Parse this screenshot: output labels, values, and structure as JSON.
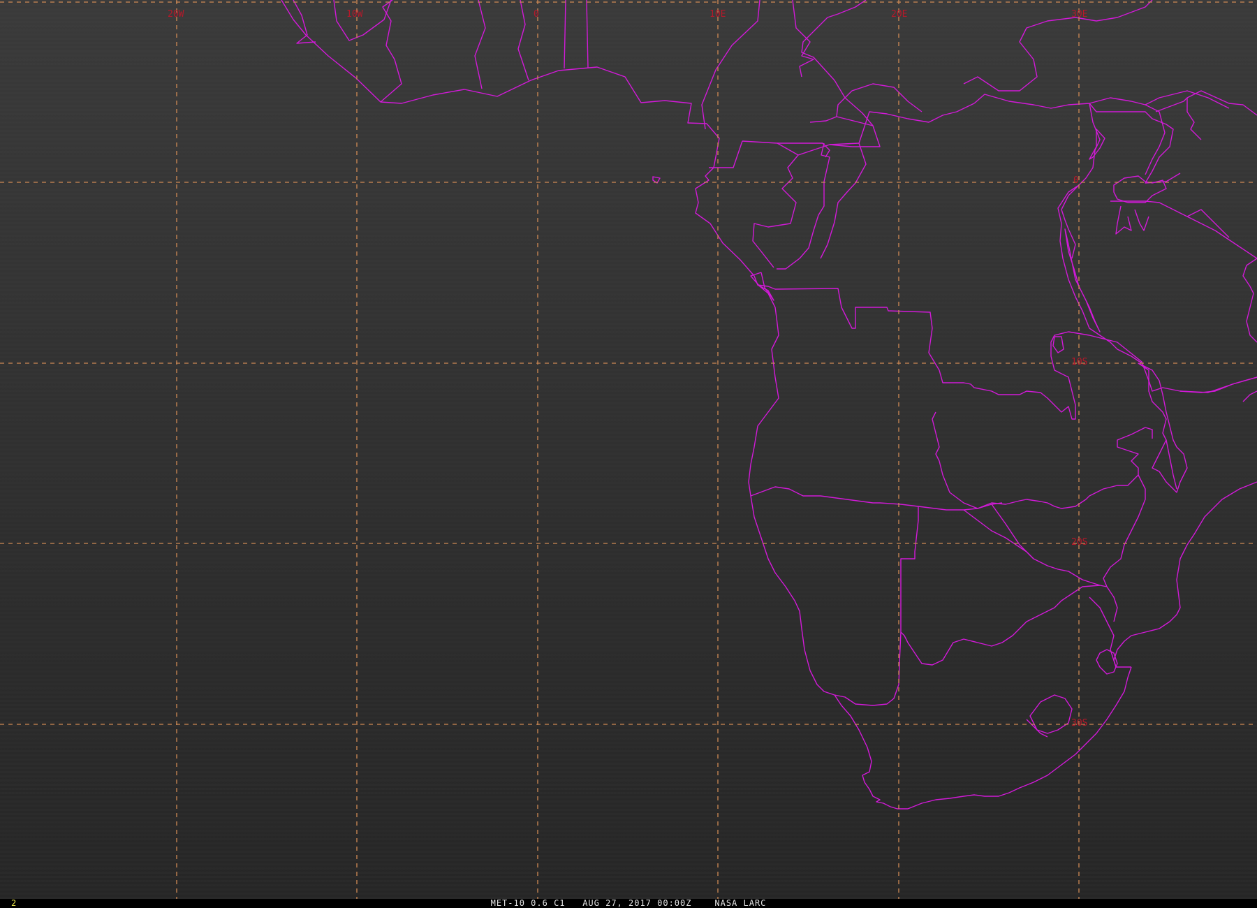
{
  "map": {
    "background_colors": [
      "#3a3a3a",
      "#262626"
    ],
    "grid_color": "#d08a55",
    "label_color": "#b8182a",
    "border_color": "#d21ad8",
    "lon_labels": [
      "20W",
      "10W",
      "0",
      "10E",
      "20E",
      "30E"
    ],
    "lat_labels": [
      "0",
      "10S",
      "20S",
      "30S"
    ]
  },
  "footer": {
    "frame_number": "2",
    "caption": "MET-10 0.6 C1   AUG 27, 2017 00:00Z    NASA LARC"
  }
}
